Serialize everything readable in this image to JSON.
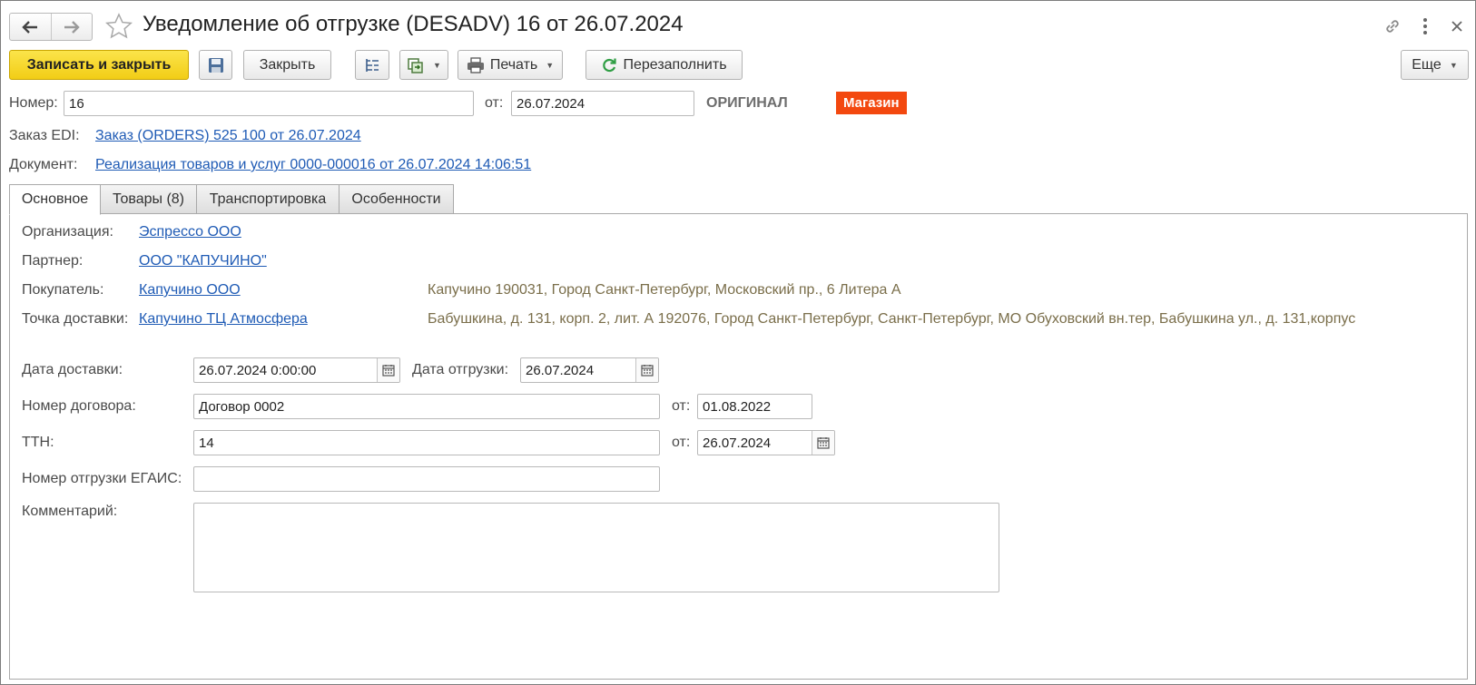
{
  "header": {
    "title": "Уведомление об отгрузке (DESADV) 16 от 26.07.2024",
    "back_icon": "arrow-left-icon",
    "forward_icon": "arrow-right-icon",
    "favorite_icon": "star-icon",
    "link_icon": "link-icon",
    "more_icon": "kebab-menu-icon",
    "close_icon": "close-icon"
  },
  "toolbar": {
    "save_close_label": "Записать и закрыть",
    "close_label": "Закрыть",
    "print_label": "Печать",
    "refill_label": "Перезаполнить",
    "more_label": "Еще"
  },
  "header_fields": {
    "number_label": "Номер:",
    "number_value": "16",
    "date_label": "от:",
    "date_value": "26.07.2024",
    "status_text": "ОРИГИНАЛ",
    "badge_text": "Магазин",
    "order_label": "Заказ EDI:",
    "order_link": "Заказ (ORDERS) 525  100 от 26.07.2024",
    "document_label": "Документ:",
    "document_link": "Реализация товаров и услуг 0000-000016 от 26.07.2024 14:06:51"
  },
  "tabs": [
    {
      "label": "Основное",
      "active": true
    },
    {
      "label": "Товары (8)",
      "active": false
    },
    {
      "label": "Транспортировка",
      "active": false
    },
    {
      "label": "Особенности",
      "active": false
    }
  ],
  "main": {
    "organization_label": "Организация:",
    "organization_value": "Эспрессо ООО",
    "partner_label": "Партнер:",
    "partner_value": "ООО \"КАПУЧИНО\"",
    "buyer_label": "Покупатель:",
    "buyer_value": "Капучино ООО",
    "buyer_address": "Капучино 190031, Город Санкт-Петербург, Московский пр., 6 Литера А",
    "delivery_point_label": "Точка доставки:",
    "delivery_point_value": "Капучино ТЦ Атмосфера",
    "delivery_point_address": "Бабушкина, д. 131, корп. 2, лит. А 192076, Город Санкт-Петербург, Санкт-Петербург, МО Обуховский вн.тер, Бабушкина ул., д. 131,корпус",
    "delivery_date_label": "Дата доставки:",
    "delivery_date_value": "26.07.2024  0:00:00",
    "shipment_date_label": "Дата отгрузки:",
    "shipment_date_value": "26.07.2024",
    "contract_label": "Номер договора:",
    "contract_value": "Договор 0002",
    "contract_date_label": "от:",
    "contract_date_value": "01.08.2022",
    "ttn_label": "ТТН:",
    "ttn_value": "14",
    "ttn_date_label": "от:",
    "ttn_date_value": "26.07.2024",
    "egais_label": "Номер отгрузки ЕГАИС:",
    "egais_value": "",
    "comment_label": "Комментарий:",
    "comment_value": ""
  },
  "colors": {
    "accent_yellow": "#f5d21c",
    "badge_orange": "#f3480f",
    "link_blue": "#1f5bb5",
    "address_olive": "#7a6e4a"
  }
}
